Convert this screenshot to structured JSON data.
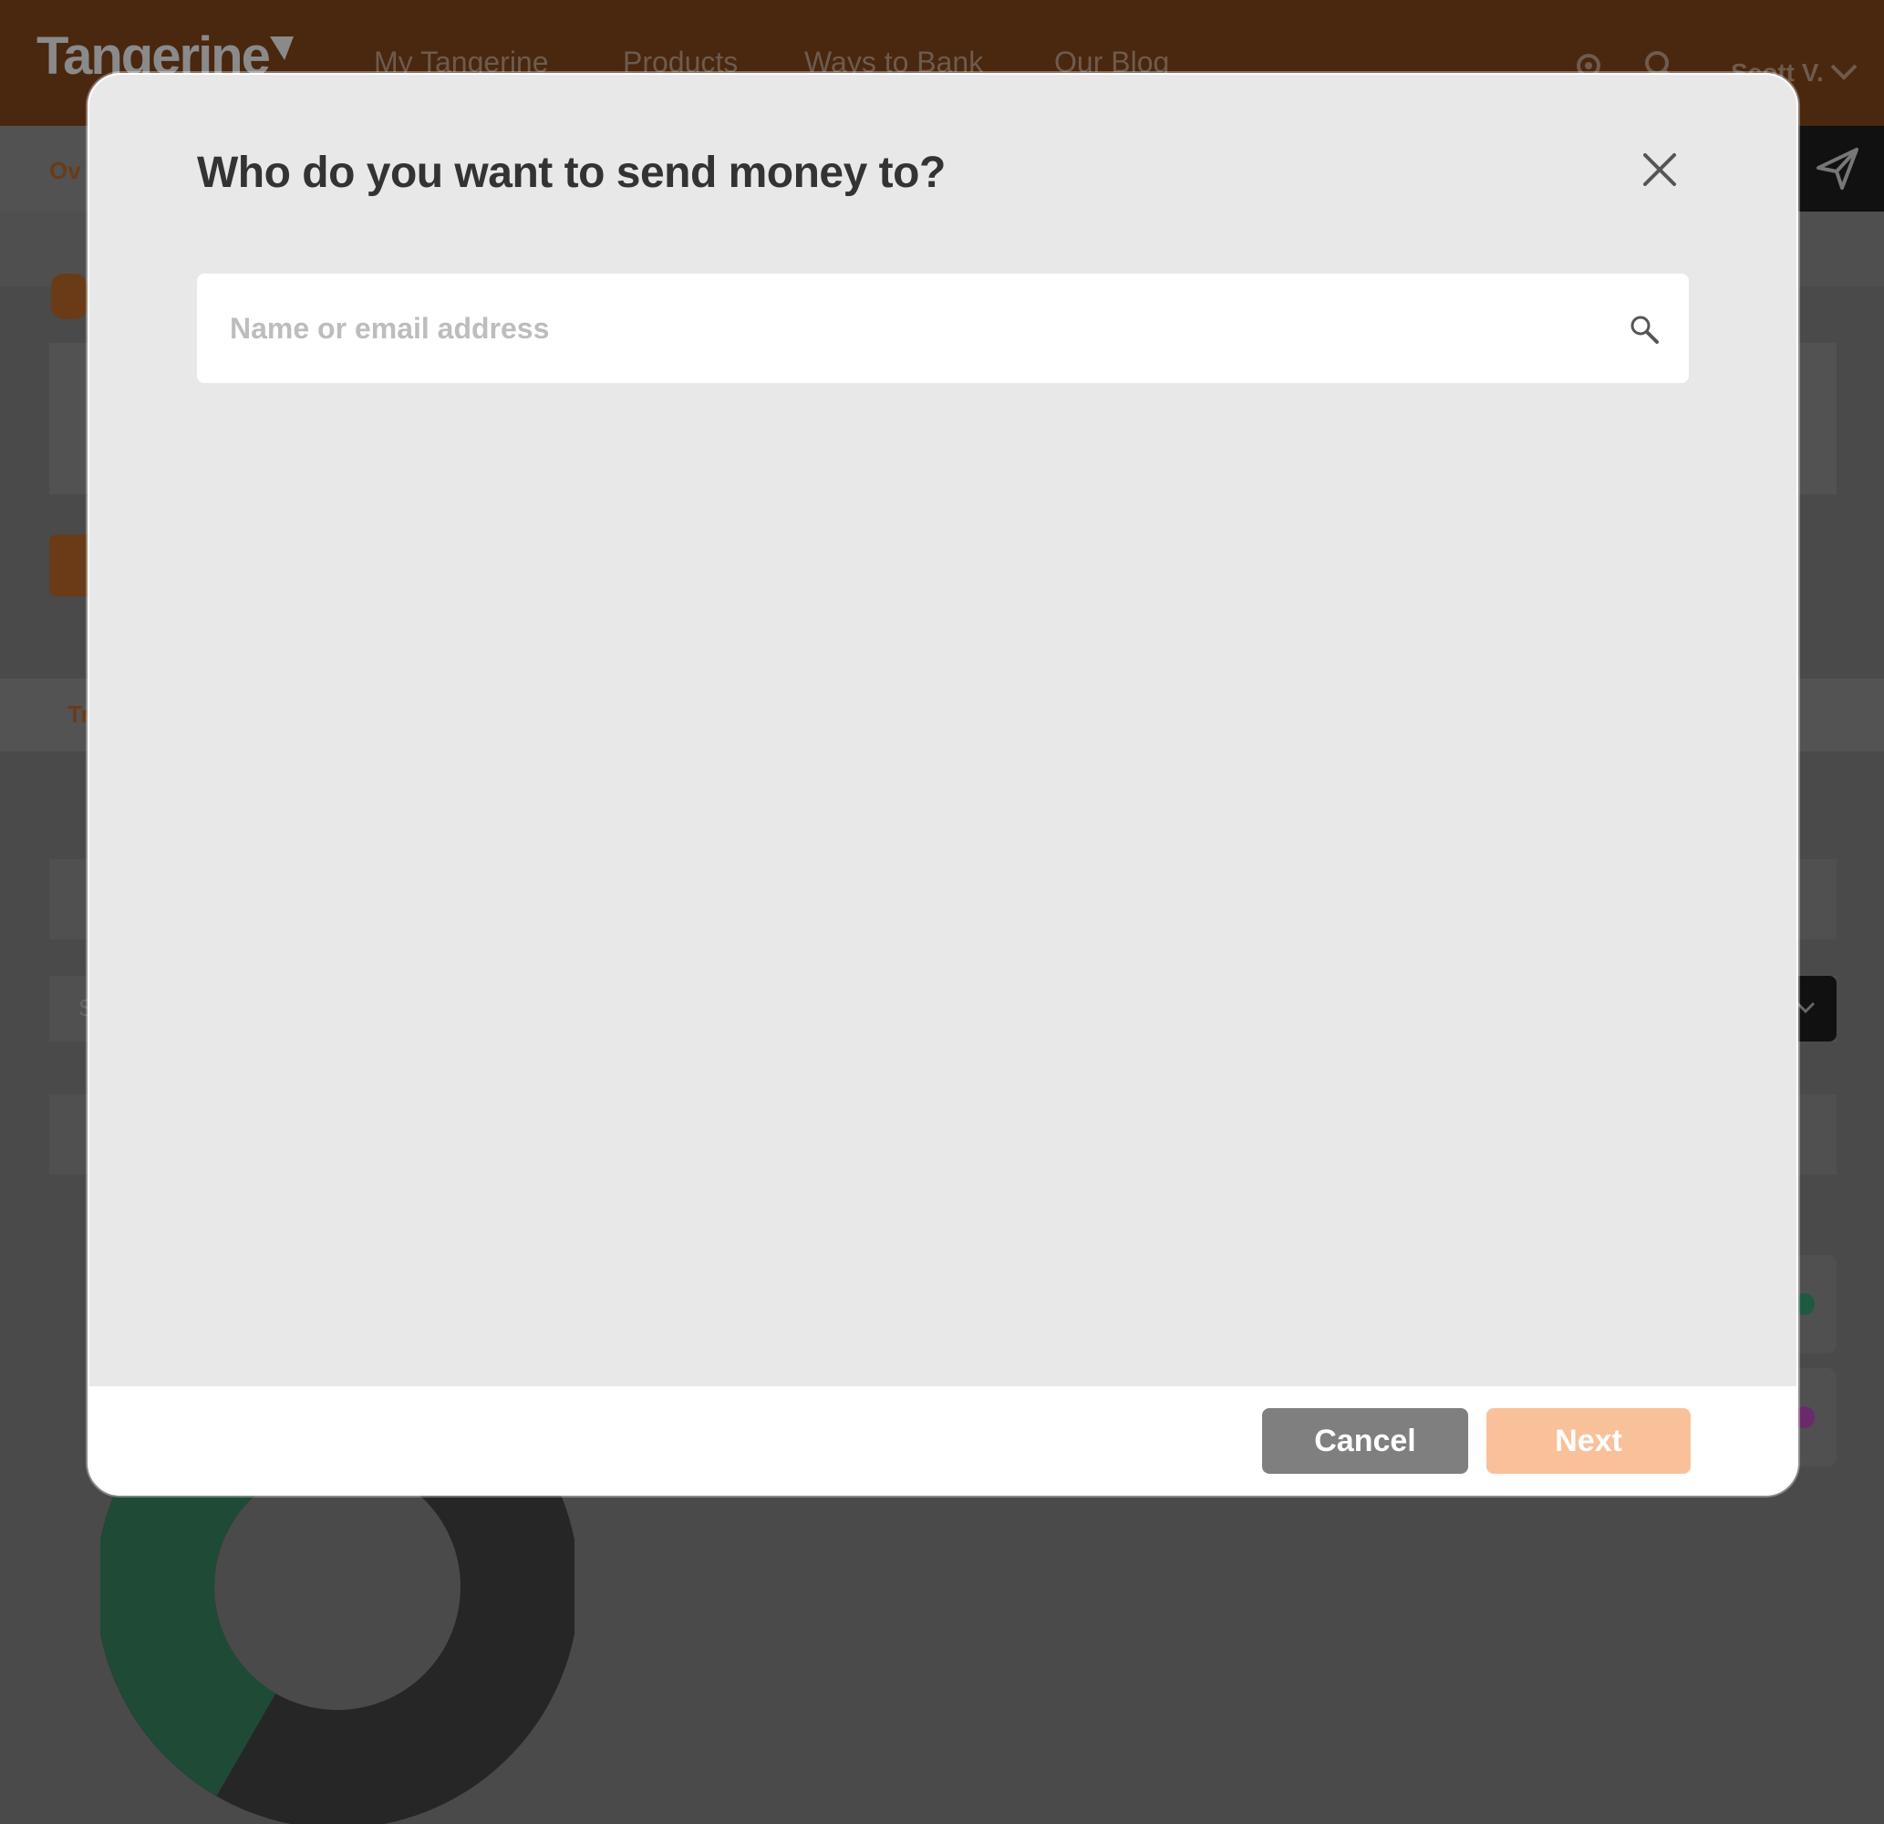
{
  "header": {
    "logo_text": "Tangerine",
    "nav": [
      "My Tangerine",
      "Products",
      "Ways to Bank",
      "Our Blog"
    ],
    "user_name": "Scott V."
  },
  "background": {
    "subnav_label": "Ov",
    "band_label": "Tr",
    "select_text": "S"
  },
  "modal": {
    "title": "Who do you want to send money to?",
    "search_placeholder": "Name or email address",
    "search_value": "",
    "cancel_label": "Cancel",
    "next_label": "Next"
  },
  "colors": {
    "brand_orange": "#f26f21",
    "next_disabled": "#f9c19a",
    "cancel_grey": "#7f7f7f"
  },
  "icons": {
    "close": "close-icon",
    "search": "search-icon",
    "location": "location-icon",
    "send": "paper-plane-icon"
  }
}
